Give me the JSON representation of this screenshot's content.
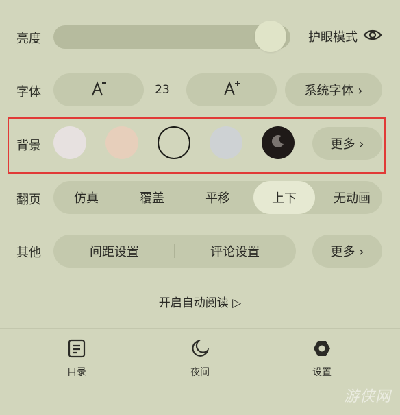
{
  "brightness": {
    "label": "亮度",
    "level": 0.95,
    "eye_mode_label": "护眼模式",
    "eye_icon": "eye-icon"
  },
  "font": {
    "label": "字体",
    "decrease_label": "A⁻",
    "size_value": "23",
    "increase_label": "A⁺",
    "system_font_label": "系统字体 ›"
  },
  "background": {
    "label": "背景",
    "options": [
      {
        "color": "#e7e1e0",
        "selected": false
      },
      {
        "color": "#e7cfbb",
        "selected": false
      },
      {
        "color": "#d2d6bc",
        "selected": true
      },
      {
        "color": "#ced2d4",
        "selected": false
      },
      {
        "color": "#1f1a18",
        "selected": false,
        "icon": "moon-icon"
      }
    ],
    "more_label": "更多 ›"
  },
  "page_turn": {
    "label": "翻页",
    "options": [
      "仿真",
      "覆盖",
      "平移",
      "上下",
      "无动画"
    ],
    "selected": "上下"
  },
  "other": {
    "label": "其他",
    "spacing_label": "间距设置",
    "comment_label": "评论设置",
    "more_label": "更多 ›"
  },
  "auto_read": {
    "label": "开启自动阅读 ▷"
  },
  "bottom_nav": {
    "items": [
      {
        "label": "目录",
        "icon": "catalog-icon"
      },
      {
        "label": "夜间",
        "icon": "moon-icon"
      },
      {
        "label": "设置",
        "icon": "settings-icon"
      }
    ]
  },
  "watermark": "游侠网",
  "colors": {
    "page_background": "#d2d6bc",
    "highlight": "#e13a37"
  }
}
